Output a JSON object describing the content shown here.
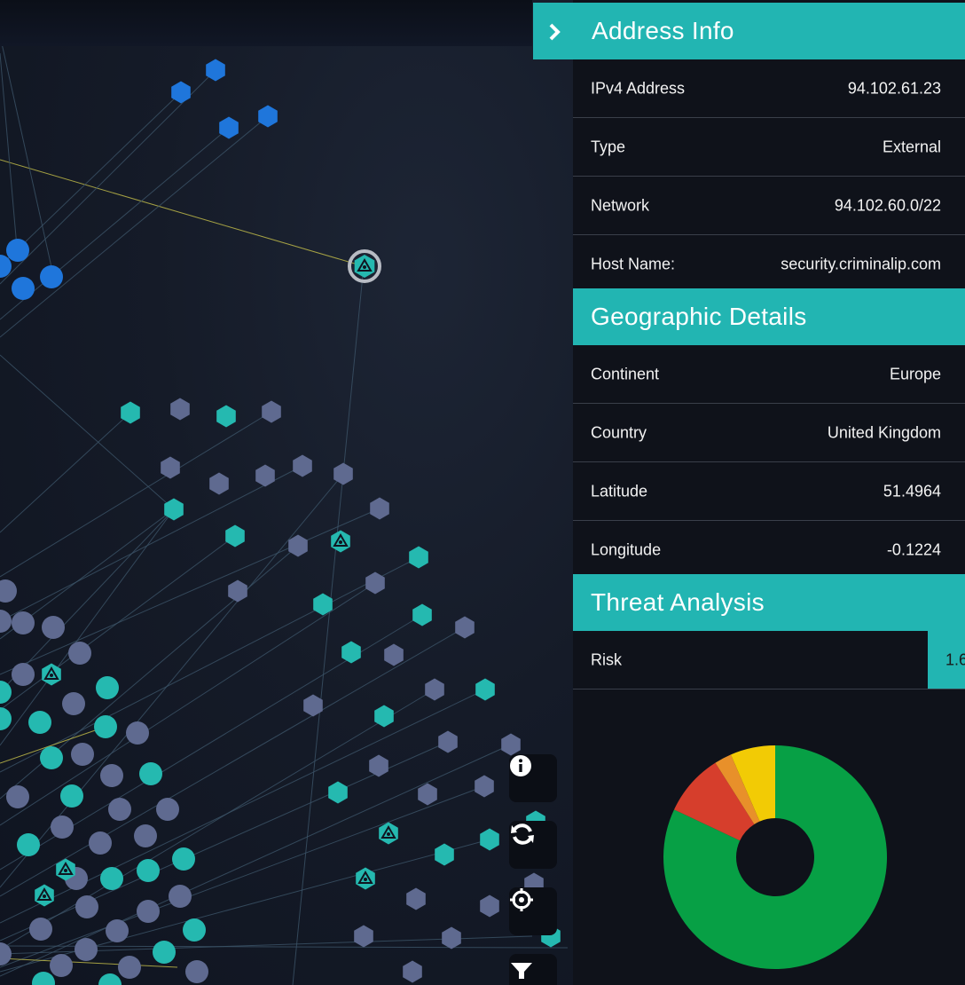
{
  "address_info": {
    "title": "Address Info",
    "rows": [
      {
        "label": "IPv4 Address",
        "value": "94.102.61.23"
      },
      {
        "label": "Type",
        "value": "External"
      },
      {
        "label": "Network",
        "value": "94.102.60.0/22"
      },
      {
        "label": "Host Name:",
        "value": "security.criminalip.com"
      }
    ]
  },
  "geographic": {
    "title": "Geographic Details",
    "rows": [
      {
        "label": "Continent",
        "value": "Europe"
      },
      {
        "label": "Country",
        "value": "United Kingdom"
      },
      {
        "label": "Latitude",
        "value": "51.4964"
      },
      {
        "label": "Longitude",
        "value": "-0.1224"
      }
    ]
  },
  "threat": {
    "title": "Threat Analysis",
    "risk_label": "Risk",
    "risk_value": "1.6"
  },
  "controls": [
    {
      "name": "info-button",
      "icon": "info-icon"
    },
    {
      "name": "refresh-button",
      "icon": "refresh-icon"
    },
    {
      "name": "center-button",
      "icon": "crosshair-icon"
    },
    {
      "name": "filter-button",
      "icon": "filter-icon"
    }
  ],
  "colors": {
    "accent": "#22b5b2",
    "node_blue": "#1f76db",
    "node_teal": "#25b9b0",
    "node_gray": "#5f6a90"
  },
  "chart_data": {
    "type": "pie",
    "donut": true,
    "slices": [
      {
        "value": 82,
        "color": "#07a045"
      },
      {
        "value": 9,
        "color": "#d63e2c"
      },
      {
        "value": 2.5,
        "color": "#e8902a"
      },
      {
        "value": 6.5,
        "color": "#f2cb05"
      }
    ]
  }
}
